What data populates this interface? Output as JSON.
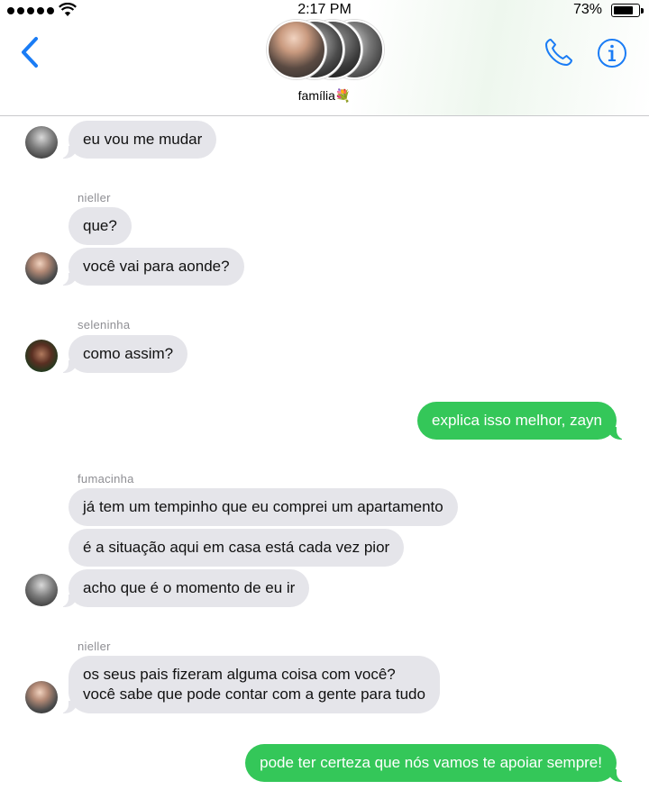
{
  "status_bar": {
    "time": "2:17 PM",
    "battery": "73%"
  },
  "header": {
    "group_name": "família💐"
  },
  "messages": [
    {
      "text": "eu vou me mudar"
    },
    {
      "sender": "nieller"
    },
    {
      "text": "que?"
    },
    {
      "text": "você vai para aonde?"
    },
    {
      "sender": "seleninha"
    },
    {
      "text": "como assim?"
    },
    {
      "text": "explica isso melhor, zayn"
    },
    {
      "sender": "fumacinha"
    },
    {
      "text": "já tem um tempinho que eu comprei um apartamento"
    },
    {
      "text": "é a situação aqui em casa está cada vez pior"
    },
    {
      "text": "acho que é o momento de eu ir"
    },
    {
      "sender": "nieller"
    },
    {
      "lines": [
        "os seus pais fizeram alguma coisa com você?",
        "você sabe que pode contar com a gente para tudo"
      ]
    },
    {
      "text": "pode ter certeza que nós vamos te apoiar sempre!"
    }
  ],
  "colors": {
    "accent": "#1a7cf5",
    "incoming_bubble": "#e5e5ea",
    "outgoing_bubble": "#34c759"
  },
  "icons": [
    "back-chevron-icon",
    "phone-icon",
    "info-icon",
    "wifi-icon",
    "battery-icon"
  ]
}
